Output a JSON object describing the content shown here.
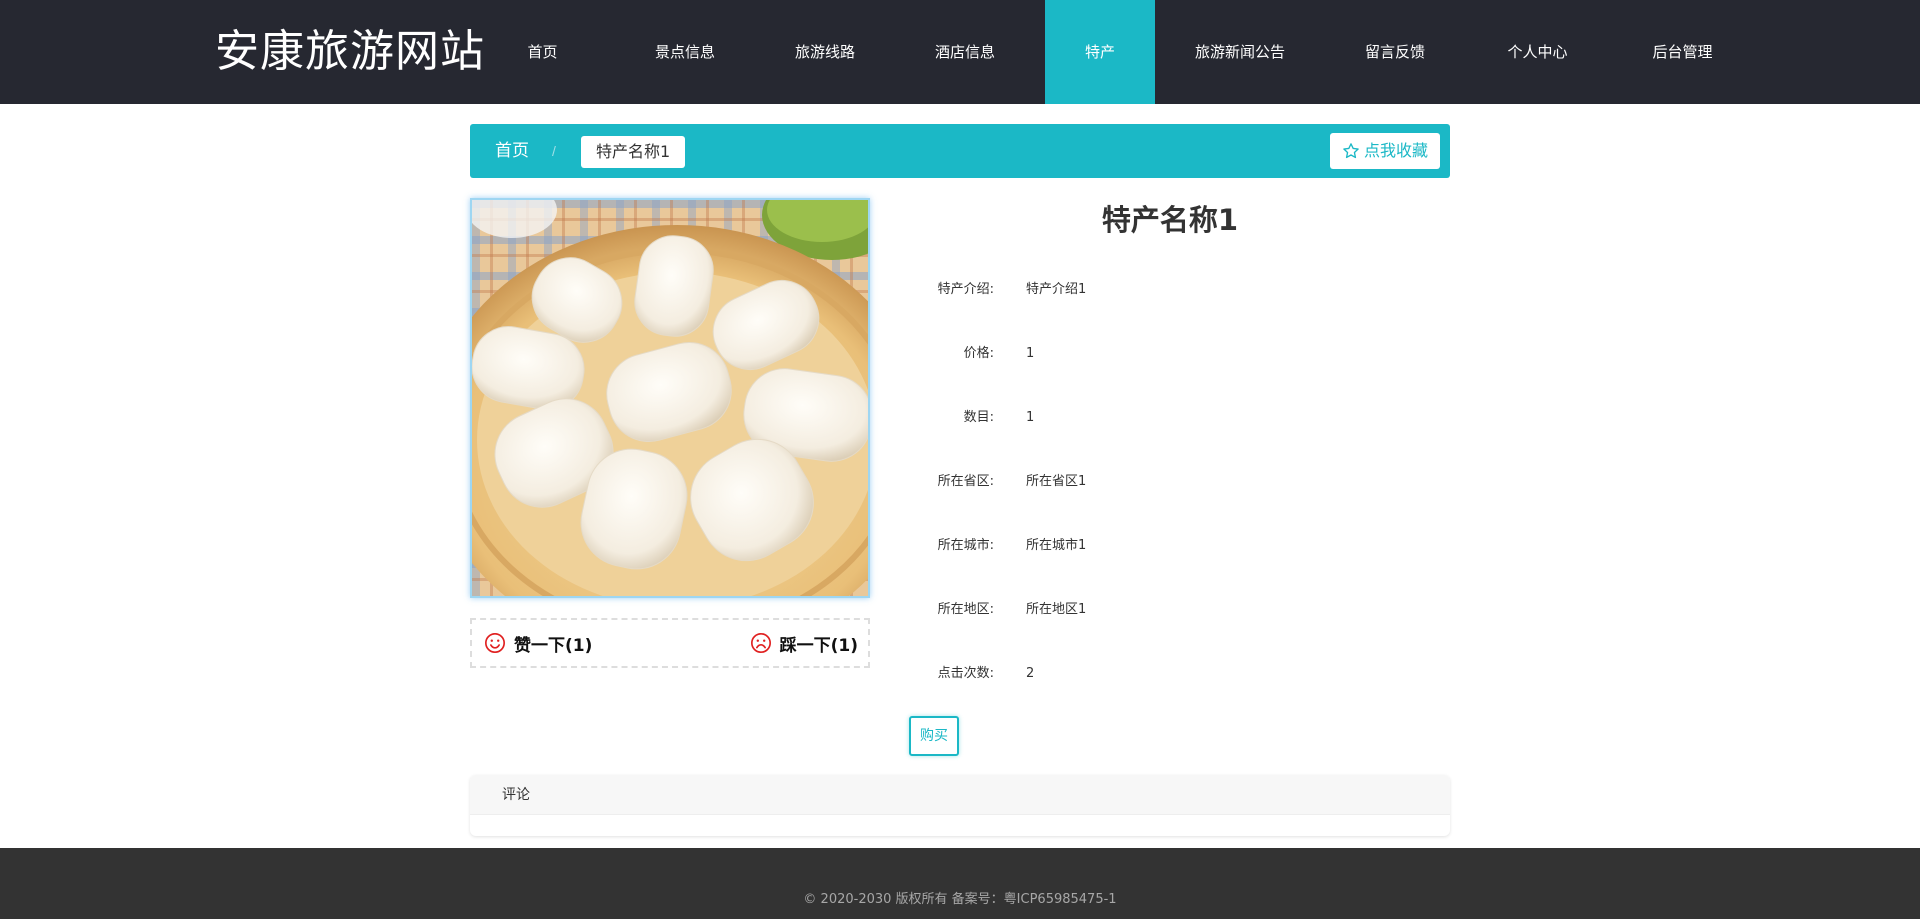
{
  "site": {
    "title": "安康旅游网站"
  },
  "nav": [
    {
      "label": "首页",
      "active": false,
      "width": 125
    },
    {
      "label": "景点信息",
      "active": false,
      "width": 160
    },
    {
      "label": "旅游线路",
      "active": false,
      "width": 120
    },
    {
      "label": "酒店信息",
      "active": false,
      "width": 160
    },
    {
      "label": "特产",
      "active": true,
      "width": 110
    },
    {
      "label": "旅游新闻公告",
      "active": false,
      "width": 170
    },
    {
      "label": "留言反馈",
      "active": false,
      "width": 140
    },
    {
      "label": "个人中心",
      "active": false,
      "width": 145
    },
    {
      "label": "后台管理",
      "active": false,
      "width": 145
    }
  ],
  "breadcrumb": {
    "home": "首页",
    "separator": "/",
    "current": "特产名称1"
  },
  "favorite": {
    "label": "点我收藏"
  },
  "product": {
    "title": "特产名称1",
    "details": [
      {
        "label": "特产介绍:",
        "value": "特产介绍1"
      },
      {
        "label": "价格:",
        "value": "1"
      },
      {
        "label": "数目:",
        "value": "1"
      },
      {
        "label": "所在省区:",
        "value": "所在省区1"
      },
      {
        "label": "所在城市:",
        "value": "所在城市1"
      },
      {
        "label": "所在地区:",
        "value": "所在地区1"
      },
      {
        "label": "点击次数:",
        "value": "2"
      }
    ]
  },
  "votes": {
    "up_label": "赞一下(1)",
    "down_label": "踩一下(1)"
  },
  "buy": {
    "label": "购买"
  },
  "comments": {
    "title": "评论"
  },
  "footer": {
    "text": "© 2020-2030 版权所有 备案号：粤ICP65985475-1"
  },
  "colors": {
    "accent": "#1bb8c6",
    "header_bg": "#262831",
    "footer_bg": "#333333",
    "vote_icon": "#e02020"
  }
}
